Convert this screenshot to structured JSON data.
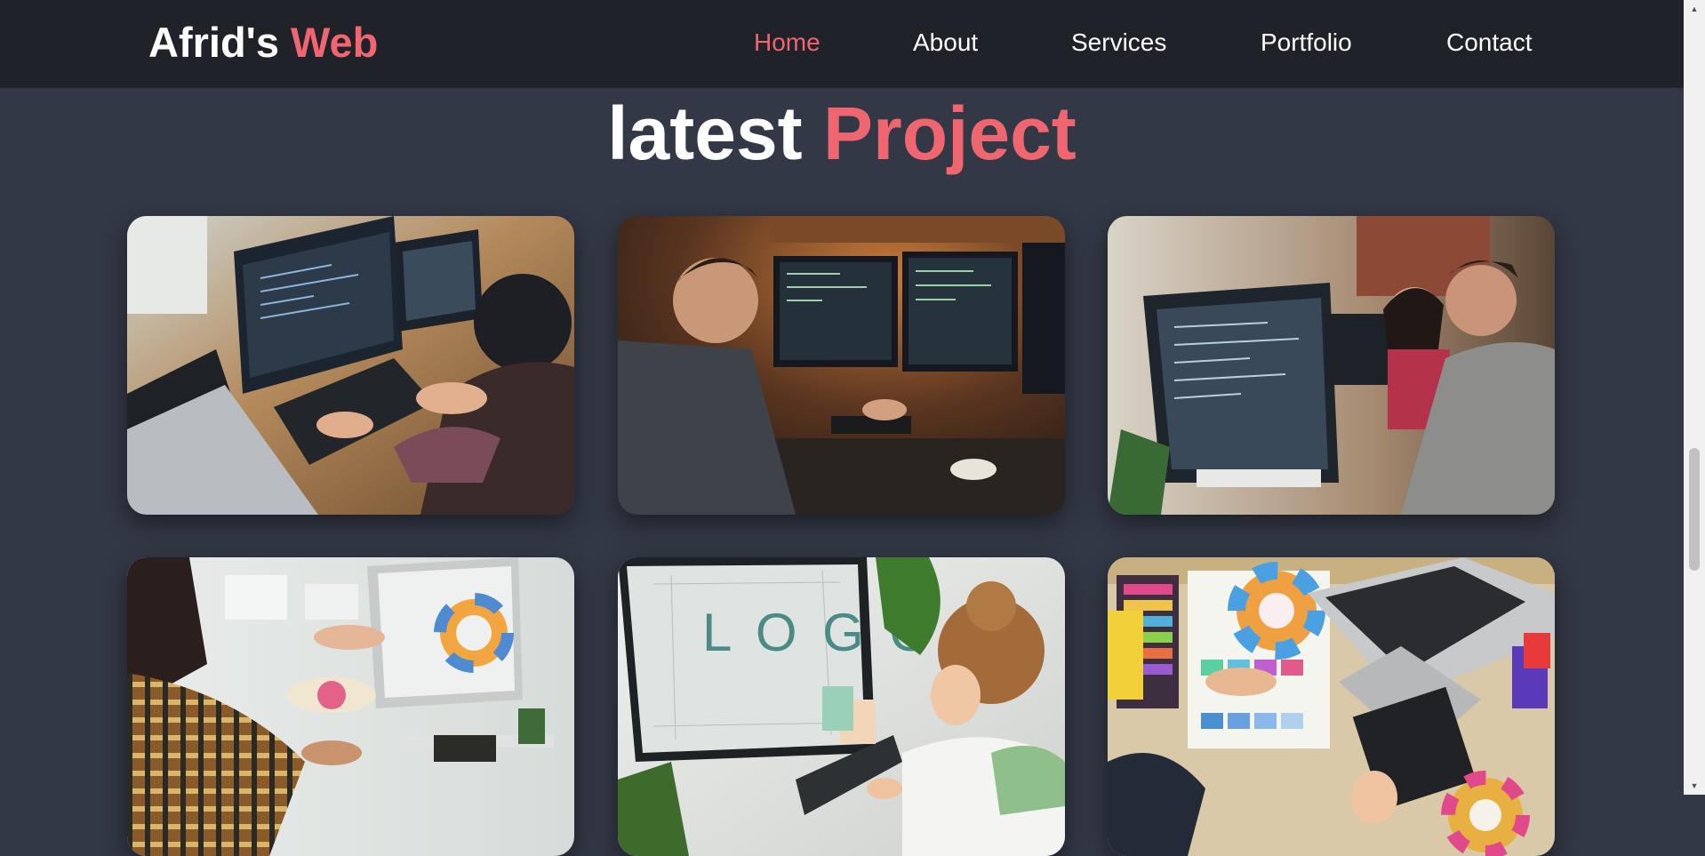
{
  "header": {
    "logo_main": "Afrid's ",
    "logo_accent": "Web",
    "nav": [
      {
        "label": "Home",
        "active": true
      },
      {
        "label": "About",
        "active": false
      },
      {
        "label": "Services",
        "active": false
      },
      {
        "label": "Portfolio",
        "active": false
      },
      {
        "label": "Contact",
        "active": false
      }
    ]
  },
  "section": {
    "title_main": "latest ",
    "title_accent": "Project"
  },
  "projects": [
    {
      "image": "developer-with-multiple-monitors-photo"
    },
    {
      "image": "programmer-at-dual-screen-desk-photo"
    },
    {
      "image": "team-coding-at-office-monitor-photo"
    },
    {
      "image": "designers-with-color-wheel-photo"
    },
    {
      "image": "logo-designer-with-tablet-photo"
    },
    {
      "image": "color-swatches-and-laptop-photo"
    }
  ],
  "colors": {
    "accent": "#ef6670",
    "header_bg": "#1f2229",
    "page_bg": "#323845",
    "text": "#ffffff"
  },
  "scrollbar": {
    "up_icon": "triangle-up-icon",
    "down_icon": "triangle-down-icon"
  }
}
